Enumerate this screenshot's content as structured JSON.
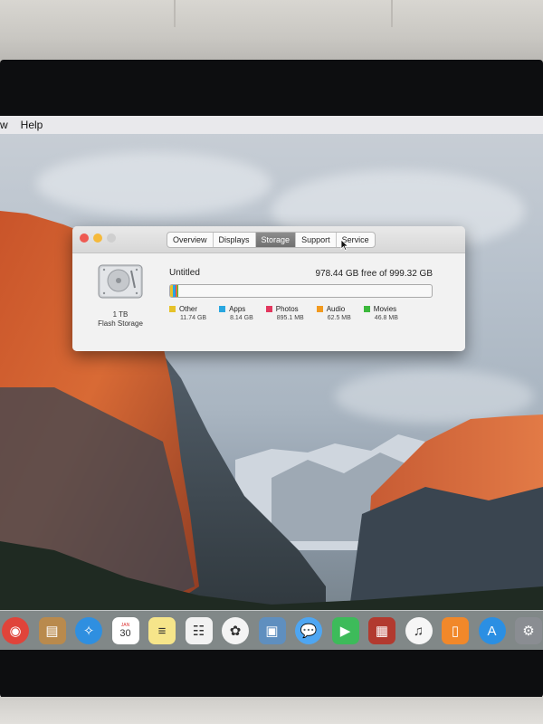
{
  "menubar": {
    "items": [
      "w",
      "Help"
    ]
  },
  "window": {
    "tabs": [
      {
        "label": "Overview",
        "active": false
      },
      {
        "label": "Displays",
        "active": false
      },
      {
        "label": "Storage",
        "active": true
      },
      {
        "label": "Support",
        "active": false
      },
      {
        "label": "Service",
        "active": false
      }
    ],
    "disk": {
      "capacity": "1 TB",
      "type": "Flash Storage"
    },
    "volume": {
      "name": "Untitled",
      "free_text": "978.44 GB free of 999.32 GB"
    },
    "legend": [
      {
        "label": "Other",
        "size": "11.74 GB",
        "color": "#e6c229",
        "fraction": 0.0117
      },
      {
        "label": "Apps",
        "size": "8.14 GB",
        "color": "#29a7e0",
        "fraction": 0.0081
      },
      {
        "label": "Photos",
        "size": "895.1 MB",
        "color": "#e2375e",
        "fraction": 0.0009
      },
      {
        "label": "Audio",
        "size": "62.5 MB",
        "color": "#f29a1f",
        "fraction": 0.0001
      },
      {
        "label": "Movies",
        "size": "46.8 MB",
        "color": "#3cb83c",
        "fraction": 0.0001
      }
    ]
  },
  "dock": {
    "icons": [
      {
        "name": "chrome-icon",
        "color": "#e0443a",
        "glyph": "◉"
      },
      {
        "name": "contacts-icon",
        "color": "#b98a4d",
        "glyph": "▤"
      },
      {
        "name": "safari-icon",
        "color": "#2f8fe0",
        "glyph": "✧"
      },
      {
        "name": "calendar-icon",
        "color": "#ffffff",
        "glyph": "30",
        "label_top": "JAN"
      },
      {
        "name": "notes-icon",
        "color": "#f6e58a",
        "glyph": "≡"
      },
      {
        "name": "reminders-icon",
        "color": "#f2f2f2",
        "glyph": "☷"
      },
      {
        "name": "photos-icon",
        "color": "#f4f4f4",
        "glyph": "✿"
      },
      {
        "name": "preview-icon",
        "color": "#5f8fbf",
        "glyph": "▣"
      },
      {
        "name": "messages-icon",
        "color": "#4ea6f2",
        "glyph": "💬"
      },
      {
        "name": "facetime-icon",
        "color": "#3dbb5a",
        "glyph": "▶"
      },
      {
        "name": "photo-booth-icon",
        "color": "#b23a2f",
        "glyph": "▦"
      },
      {
        "name": "itunes-icon",
        "color": "#f6f6f6",
        "glyph": "♫"
      },
      {
        "name": "ibooks-icon",
        "color": "#f1882a",
        "glyph": "▯"
      },
      {
        "name": "app-store-icon",
        "color": "#2b8fe3",
        "glyph": "A"
      },
      {
        "name": "system-preferences-icon",
        "color": "#8a8d92",
        "glyph": "⚙"
      }
    ]
  }
}
